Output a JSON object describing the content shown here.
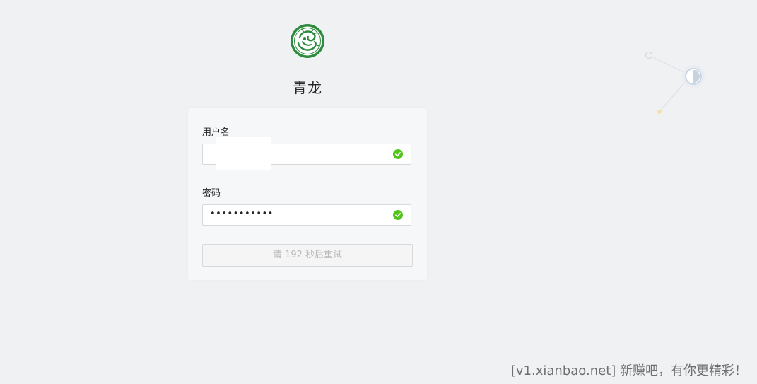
{
  "app": {
    "title": "青龙"
  },
  "login_form": {
    "username": {
      "label": "用户名",
      "value": ""
    },
    "password": {
      "label": "密码",
      "masked_value": "•••••••••••"
    },
    "submit_label": "请 192 秒后重试"
  },
  "watermark": {
    "text": "[v1.xianbao.net] 新赚吧，有你更精彩！"
  },
  "colors": {
    "page_background": "#f0f1f3",
    "card_background": "#f6f7f9",
    "success_green": "#52c41a",
    "logo_green": "#2e8b3e",
    "disabled_text": "#b8b8b8"
  }
}
